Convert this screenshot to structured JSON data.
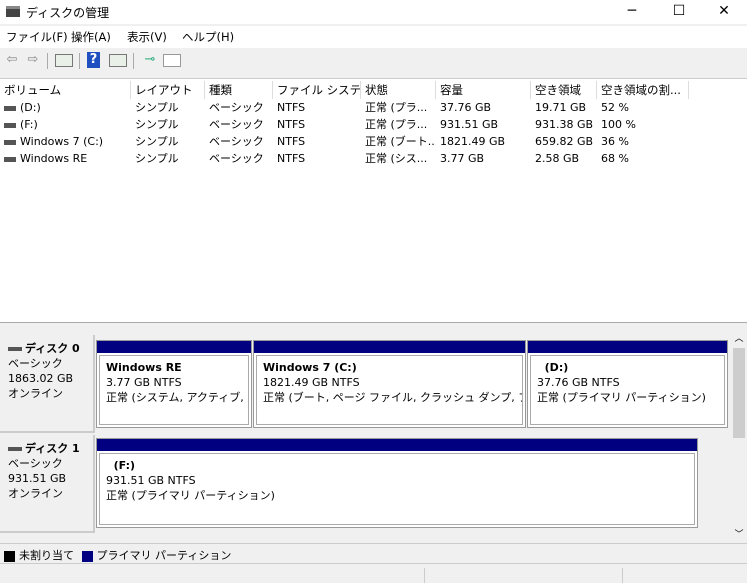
{
  "window": {
    "title": "ディスクの管理",
    "minimize": "─",
    "maximize": "☐",
    "close": "✕"
  },
  "menu": [
    "ファイル(F)",
    "操作(A)",
    "表示(V)",
    "ヘルプ(H)"
  ],
  "toolbar": {
    "back": "⇦",
    "forward": "⇨",
    "help": "?"
  },
  "columns": [
    "ボリューム",
    "レイアウト",
    "種類",
    "ファイル システム",
    "状態",
    "容量",
    "空き領域",
    "空き領域の割..."
  ],
  "volumes": [
    [
      "(D:)",
      "シンプル",
      "ベーシック",
      "NTFS",
      "正常 (プラ...",
      "37.76 GB",
      "19.71 GB",
      "52 %"
    ],
    [
      "(F:)",
      "シンプル",
      "ベーシック",
      "NTFS",
      "正常 (プラ...",
      "931.51 GB",
      "931.38 GB",
      "100 %"
    ],
    [
      "Windows 7 (C:)",
      "シンプル",
      "ベーシック",
      "NTFS",
      "正常 (ブート...",
      "1821.49 GB",
      "659.82 GB",
      "36 %"
    ],
    [
      "Windows RE",
      "シンプル",
      "ベーシック",
      "NTFS",
      "正常 (シス...",
      "3.77 GB",
      "2.58 GB",
      "68 %"
    ]
  ],
  "disks": [
    {
      "name": "ディスク 0",
      "type": "ベーシック",
      "size": "1863.02 GB",
      "state": "オンライン",
      "partitions": [
        {
          "name": "Windows RE",
          "size": "3.77 GB NTFS",
          "status": "正常 (システム, アクティブ, プライマリ パーティション)"
        },
        {
          "name": "Windows 7  (C:)",
          "size": "1821.49 GB NTFS",
          "status": "正常 (ブート, ページ ファイル, クラッシュ ダンプ, プライマリ パーティション)"
        },
        {
          "name": "  (D:)",
          "size": "37.76 GB NTFS",
          "status": "正常 (プライマリ パーティション)"
        }
      ]
    },
    {
      "name": "ディスク 1",
      "type": "ベーシック",
      "size": "931.51 GB",
      "state": "オンライン",
      "partitions": [
        {
          "name": "  (F:)",
          "size": "931.51 GB NTFS",
          "status": "正常 (プライマリ パーティション)"
        }
      ]
    }
  ],
  "legend": {
    "unallocated": "未割り当て",
    "primary": "プライマリ パーティション",
    "colors": {
      "unallocated": "#000000",
      "primary": "#000080"
    }
  }
}
